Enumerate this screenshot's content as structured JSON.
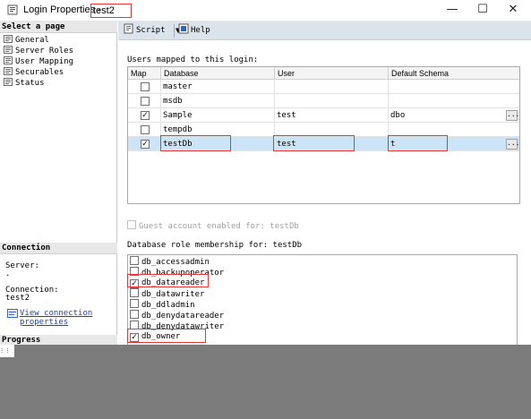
{
  "window": {
    "title": "Login Properties - ",
    "login_name": "test2",
    "minimize_glyph": "—",
    "maximize_glyph": "☐",
    "close_glyph": "✕"
  },
  "left": {
    "select_page_header": "Select a page",
    "pages": [
      "General",
      "Server Roles",
      "User Mapping",
      "Securables",
      "Status"
    ],
    "connection_header": "Connection",
    "server_label": "Server:",
    "server_value": ".",
    "connection_label": "Connection:",
    "connection_value": "test2",
    "view_link_line1": "View connection",
    "view_link_line2": "properties",
    "progress_header": "Progress"
  },
  "toolbar": {
    "script_label": "Script",
    "script_dropdown_glyph": "▼",
    "help_label": "Help"
  },
  "users_mapped_label": "Users mapped to this login:",
  "grid": {
    "columns": [
      "Map",
      "Database",
      "User",
      "Default Schema"
    ],
    "rows": [
      {
        "map": false,
        "database": "master",
        "user": "",
        "schema": "",
        "has_browse": false
      },
      {
        "map": false,
        "database": "msdb",
        "user": "",
        "schema": "",
        "has_browse": false
      },
      {
        "map": true,
        "database": "Sample",
        "user": "test",
        "schema": "dbo",
        "has_browse": true
      },
      {
        "map": false,
        "database": "tempdb",
        "user": "",
        "schema": "",
        "has_browse": false
      },
      {
        "map": true,
        "database": "testDb",
        "user": "test",
        "schema": "t",
        "has_browse": true
      }
    ],
    "selected_row_index": 4,
    "browse_glyph": "..."
  },
  "guest_label": "Guest account enabled for: testDb",
  "role_membership_label": "Database role membership for: testDb",
  "roles": [
    {
      "name": "db_accessadmin",
      "checked": false
    },
    {
      "name": "db_backupoperator",
      "checked": false
    },
    {
      "name": "db_datareader",
      "checked": true
    },
    {
      "name": "db_datawriter",
      "checked": false
    },
    {
      "name": "db_ddladmin",
      "checked": false
    },
    {
      "name": "db_denydatareader",
      "checked": false
    },
    {
      "name": "db_denydatawriter",
      "checked": false
    },
    {
      "name": "db_owner",
      "checked": true
    }
  ],
  "check_glyph": "✓",
  "corner_text": "⁝ ⁝"
}
